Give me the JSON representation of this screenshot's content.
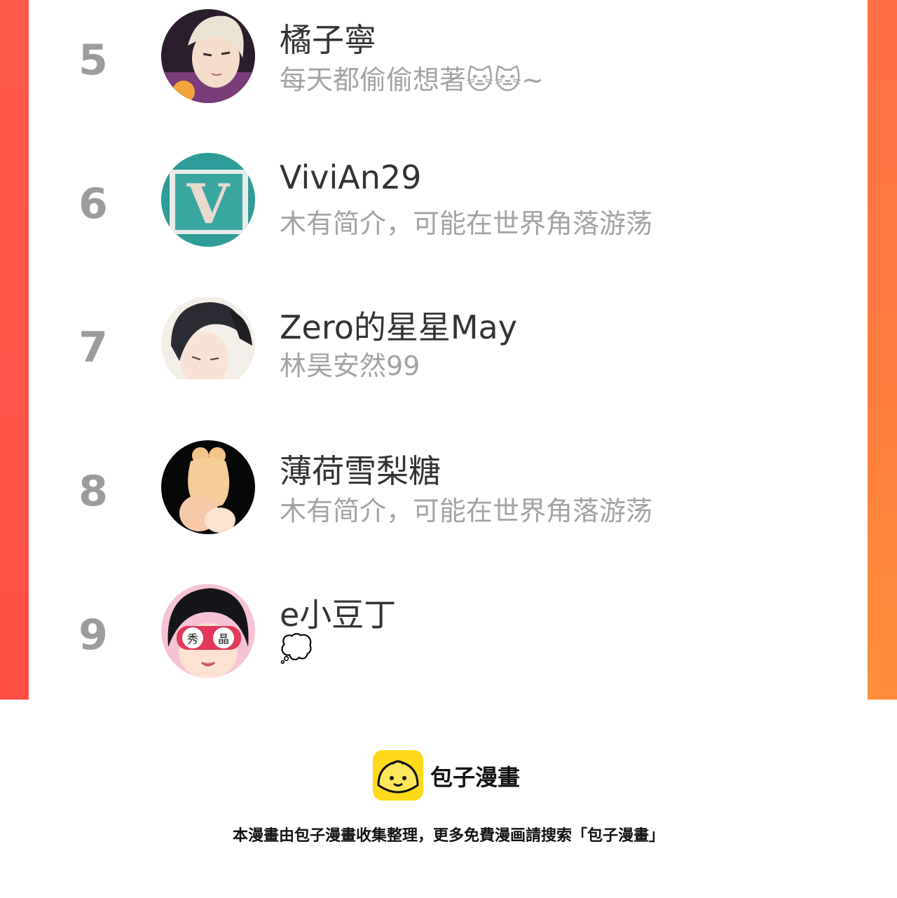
{
  "users": [
    {
      "rank": "5",
      "name": "橘子寧",
      "bio": "每天都偷偷想著🐱🐱~",
      "avatar": "avatar-illustration-blond-man"
    },
    {
      "rank": "6",
      "name": "ViviAn29",
      "bio": "木有简介，可能在世界角落游荡",
      "avatar": "avatar-letter-v"
    },
    {
      "rank": "7",
      "name": "Zero的星星May",
      "bio": "林昊安然99",
      "avatar": "avatar-illustration-dark-hair"
    },
    {
      "rank": "8",
      "name": "薄荷雪梨糖",
      "bio": "木有简介，可能在世界角落游荡",
      "avatar": "avatar-illustration-blonde-girl"
    },
    {
      "rank": "9",
      "name": "e小豆丁",
      "bio": "💭",
      "avatar": "avatar-illustration-girl-glasses"
    }
  ],
  "avatar_glasses_text": [
    "秀",
    "晶"
  ],
  "avatar_letter": "V",
  "footer": {
    "brand": "包子漫畫",
    "note": "本漫畫由包子漫畫收集整理，更多免費漫画請搜索「包子漫畫」"
  },
  "colors": {
    "accent_left": "#ff5a4a",
    "accent_right": "#ff7f3e",
    "logo": "#ffd91a"
  }
}
